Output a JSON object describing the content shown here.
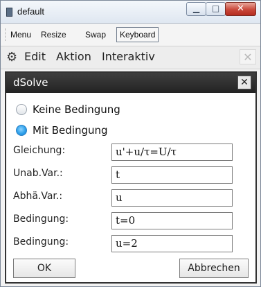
{
  "window": {
    "title": "default",
    "minimize_glyph": "▁",
    "maximize_glyph": "□",
    "close_glyph": "✕"
  },
  "menubar": {
    "items": [
      "Menu",
      "Resize",
      "Swap"
    ],
    "keyboard_label": "Keyboard"
  },
  "toolbar": {
    "gear_glyph": "⚙",
    "items": [
      "Edit",
      "Aktion",
      "Interaktiv"
    ],
    "close_glyph": "✕"
  },
  "dialog": {
    "title": "dSolve",
    "close_glyph": "✕",
    "radio_options": [
      {
        "label": "Keine Bedingung",
        "selected": false
      },
      {
        "label": "Mit Bedingung",
        "selected": true
      }
    ],
    "fields": [
      {
        "label": "Gleichung:",
        "value": "u'+u/τ=U/τ"
      },
      {
        "label": "Unab.Var.:",
        "value": "t"
      },
      {
        "label": "Abhä.Var.:",
        "value": "u"
      },
      {
        "label": "Bedingung:",
        "value": "t=0"
      },
      {
        "label": "Bedingung:",
        "value": "u=2"
      }
    ],
    "ok_label": "OK",
    "cancel_label": "Abbrechen"
  },
  "colors": {
    "dialog_header": "#2b2b2b",
    "radio_selected": "#2ea0ea",
    "window_close": "#c9483a"
  }
}
